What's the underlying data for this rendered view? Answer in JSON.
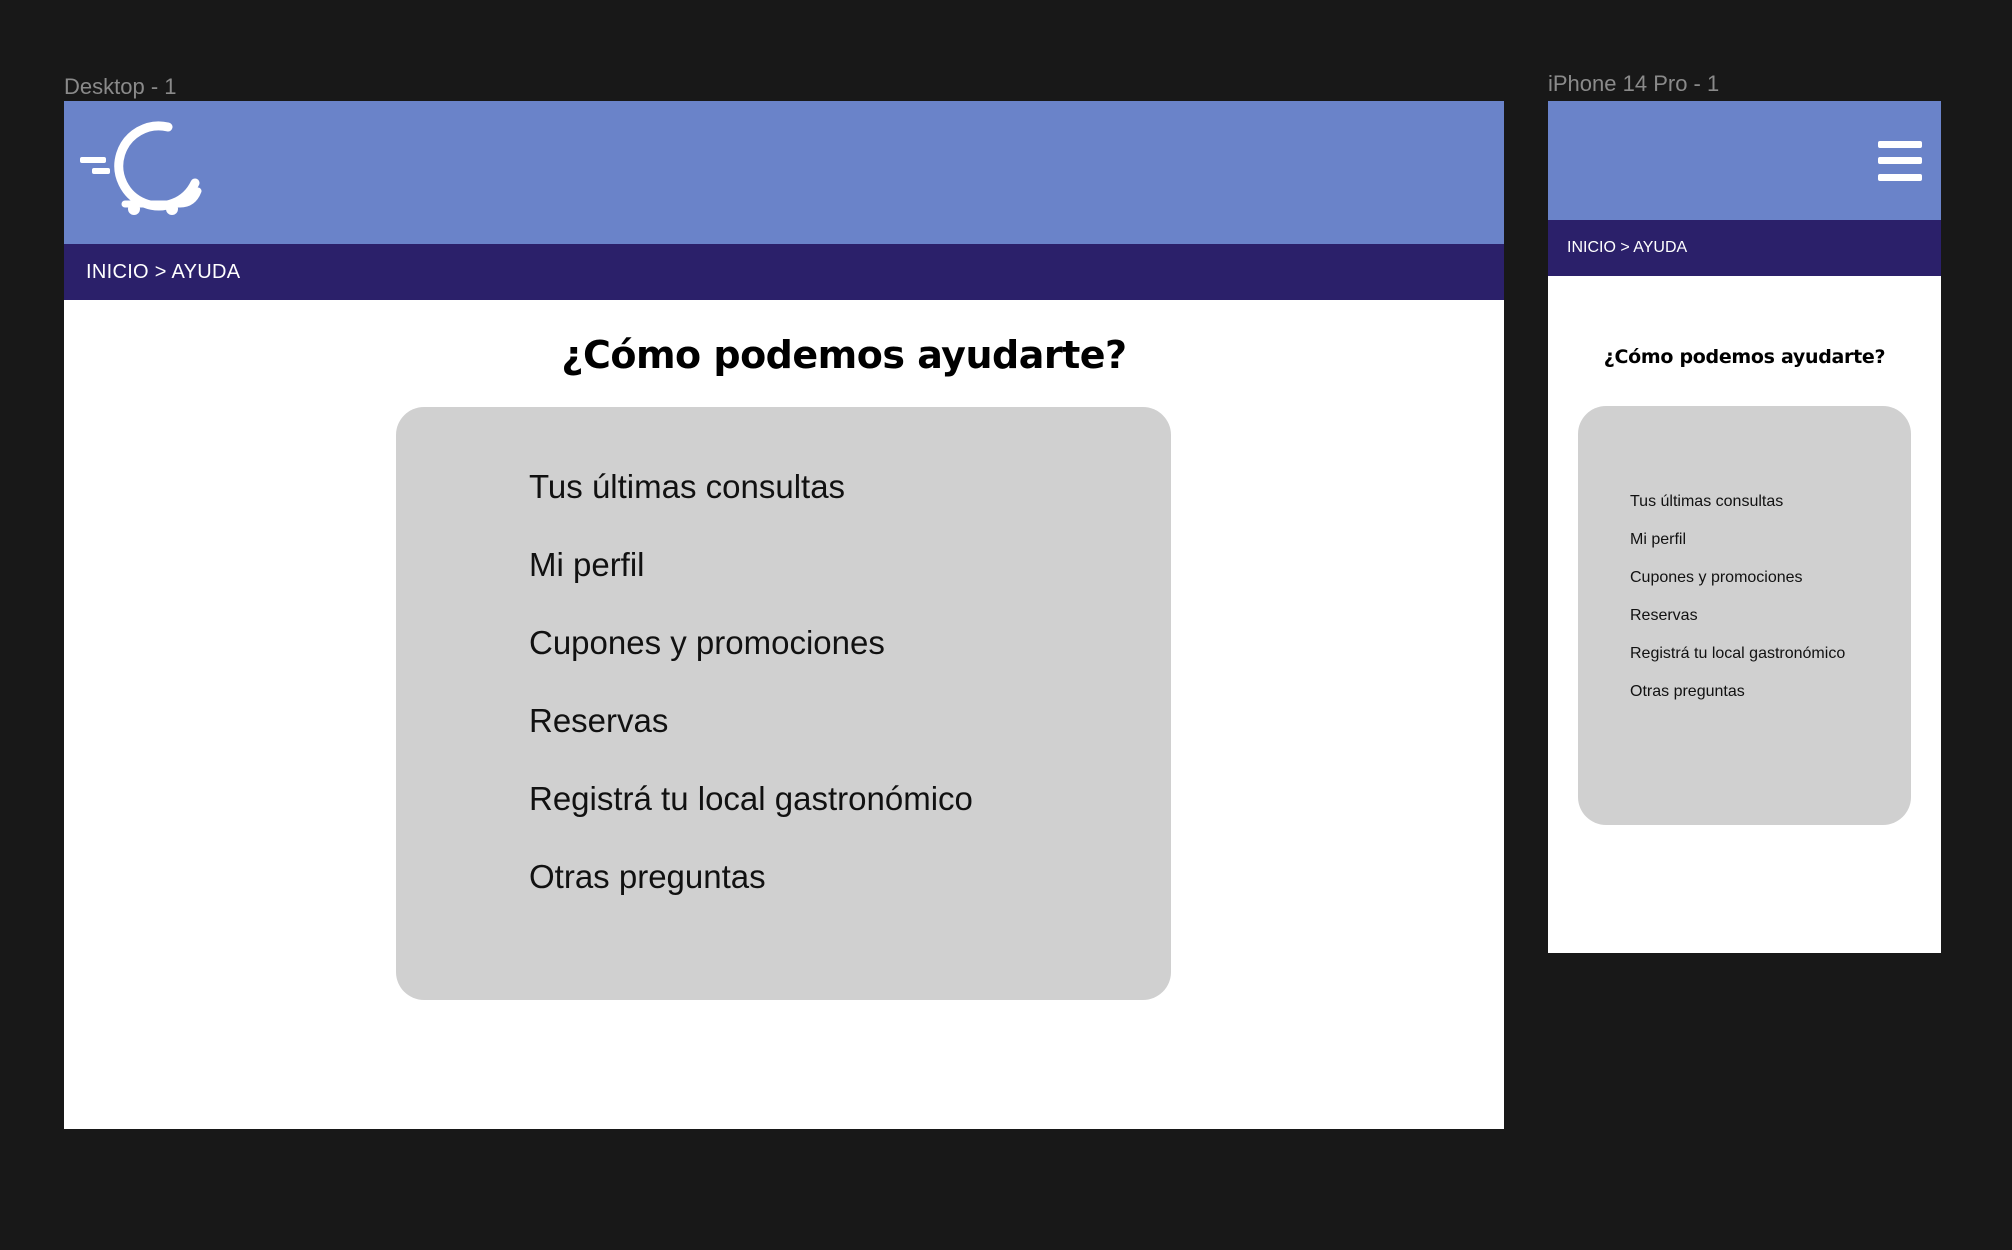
{
  "frames": {
    "desktop_label": "Desktop - 1",
    "mobile_label": "iPhone 14 Pro - 1"
  },
  "colors": {
    "header": "#6a83c9",
    "breadcrumb_bar": "#2b206a",
    "card": "#d0d0d0",
    "canvas": "#181818"
  },
  "desktop": {
    "logo_icon": "cart-c-logo-icon",
    "breadcrumb": "INICIO > AYUDA",
    "title": "¿Cómo podemos ayudarte?",
    "menu": [
      "Tus últimas consultas",
      "Mi perfil",
      "Cupones y promociones",
      "Reservas",
      "Registrá tu local gastronómico",
      "Otras preguntas"
    ]
  },
  "mobile": {
    "menu_icon": "hamburger-icon",
    "breadcrumb": "INICIO > AYUDA",
    "title": "¿Cómo podemos ayudarte?",
    "menu": [
      "Tus últimas consultas",
      "Mi perfil",
      "Cupones y promociones",
      "Reservas",
      "Registrá tu local gastronómico",
      "Otras preguntas"
    ]
  }
}
